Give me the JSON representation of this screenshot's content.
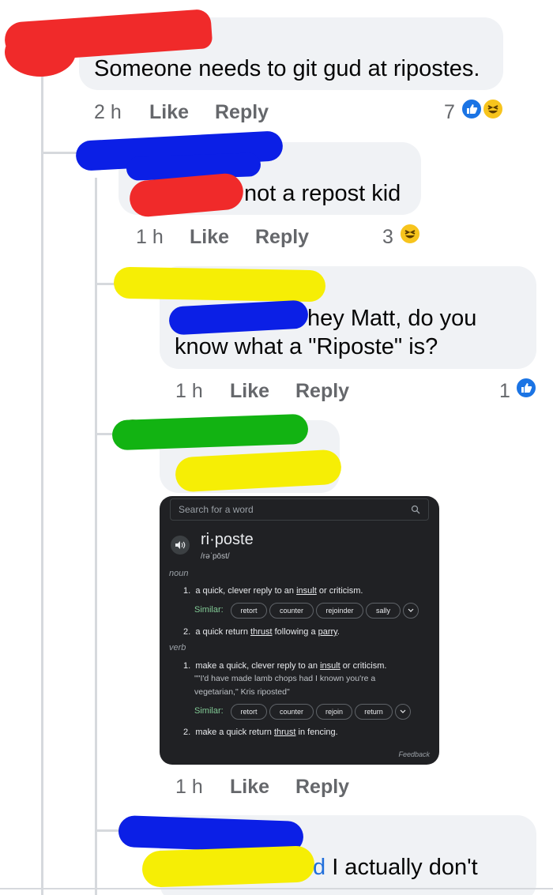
{
  "comments": [
    {
      "text": "Someone needs to git gud at ripostes.",
      "time": "2 h",
      "like_label": "Like",
      "reply_label": "Reply",
      "reaction_count": "7"
    },
    {
      "text": "not a repost kid",
      "time": "1 h",
      "like_label": "Like",
      "reply_label": "Reply",
      "reaction_count": "3"
    },
    {
      "text_line1": "hey Matt, do you",
      "text_line2": "know what a \"Riposte\" is?",
      "time": "1 h",
      "like_label": "Like",
      "reply_label": "Reply",
      "reaction_count": "1"
    },
    {
      "time": "1 h",
      "like_label": "Like",
      "reply_label": "Reply"
    },
    {
      "text": "d I actually don't"
    }
  ],
  "dictionary": {
    "search_placeholder": "Search for a word",
    "word": "ri·poste",
    "phonetic": "/rəˈpōst/",
    "noun_label": "noun",
    "verb_label": "verb",
    "noun_def1_num": "1.",
    "noun_def1_a": "a quick, clever reply to an ",
    "noun_def1_link": "insult",
    "noun_def1_b": " or criticism.",
    "similar_label": "Similar:",
    "noun_similar": [
      "retort",
      "counter",
      "rejoinder",
      "sally"
    ],
    "noun_def2_num": "2.",
    "noun_def2_a": "a quick return ",
    "noun_def2_link1": "thrust",
    "noun_def2_b": " following a ",
    "noun_def2_link2": "parry",
    "noun_def2_c": ".",
    "verb_def1_num": "1.",
    "verb_def1_a": "make a quick, clever reply to an ",
    "verb_def1_link": "insult",
    "verb_def1_b": " or criticism.",
    "verb_example_line1": "\"\"I'd have made lamb chops had I known you're a",
    "verb_example_line2": "vegetarian,\" Kris riposted\"",
    "verb_similar": [
      "retort",
      "counter",
      "rejoin",
      "return"
    ],
    "verb_def2_num": "2.",
    "verb_def2_a": "make a quick return ",
    "verb_def2_link": "thrust",
    "verb_def2_b": " in fencing.",
    "feedback": "Feedback"
  },
  "colors": {
    "bubble": "#f0f2f5",
    "meta": "#65676b",
    "like_blue": "#1b74e4",
    "red_marker": "#f02a2a",
    "blue_marker": "#0b1fe6",
    "yellow_marker": "#f6ee05",
    "green_marker": "#12b312"
  }
}
